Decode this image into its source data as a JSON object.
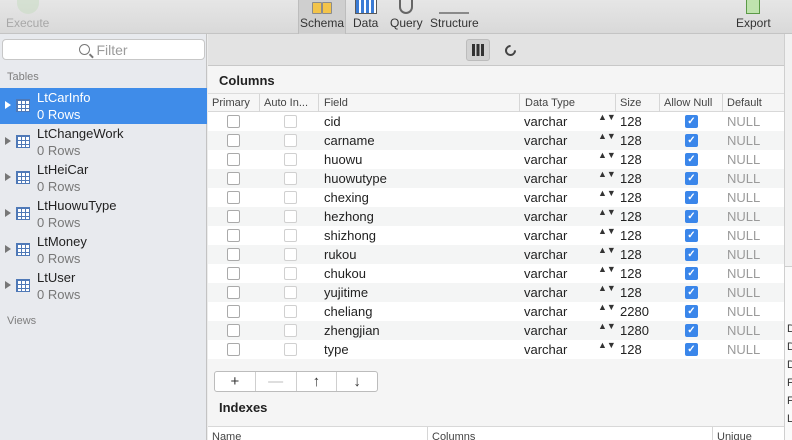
{
  "toolbar": {
    "execute": "Execute",
    "schema": "Schema",
    "data": "Data",
    "query": "Query",
    "structure": "Structure",
    "export": "Export"
  },
  "sidebar": {
    "filter_placeholder": "Filter",
    "tables_label": "Tables",
    "views_label": "Views",
    "tables": [
      {
        "name": "LtCarInfo",
        "rows": "0 Rows"
      },
      {
        "name": "LtChangeWork",
        "rows": "0 Rows"
      },
      {
        "name": "LtHeiCar",
        "rows": "0 Rows"
      },
      {
        "name": "LtHuowuType",
        "rows": "0 Rows"
      },
      {
        "name": "LtMoney",
        "rows": "0 Rows"
      },
      {
        "name": "LtUser",
        "rows": "0 Rows"
      }
    ]
  },
  "columns": {
    "title": "Columns",
    "headers": [
      "Primary",
      "Auto In...",
      "Field",
      "Data Type",
      "Size",
      "Allow Null",
      "Default"
    ],
    "rows": [
      {
        "field": "cid",
        "type": "varchar",
        "size": "128",
        "default": "NULL"
      },
      {
        "field": "carname",
        "type": "varchar",
        "size": "128",
        "default": "NULL"
      },
      {
        "field": "huowu",
        "type": "varchar",
        "size": "128",
        "default": "NULL"
      },
      {
        "field": "huowutype",
        "type": "varchar",
        "size": "128",
        "default": "NULL"
      },
      {
        "field": "chexing",
        "type": "varchar",
        "size": "128",
        "default": "NULL"
      },
      {
        "field": "hezhong",
        "type": "varchar",
        "size": "128",
        "default": "NULL"
      },
      {
        "field": "shizhong",
        "type": "varchar",
        "size": "128",
        "default": "NULL"
      },
      {
        "field": "rukou",
        "type": "varchar",
        "size": "128",
        "default": "NULL"
      },
      {
        "field": "chukou",
        "type": "varchar",
        "size": "128",
        "default": "NULL"
      },
      {
        "field": "yujitime",
        "type": "varchar",
        "size": "128",
        "default": "NULL"
      },
      {
        "field": "cheliang",
        "type": "varchar",
        "size": "2280",
        "default": "NULL"
      },
      {
        "field": "zhengjian",
        "type": "varchar",
        "size": "1280",
        "default": "NULL"
      },
      {
        "field": "type",
        "type": "varchar",
        "size": "128",
        "default": "NULL"
      }
    ]
  },
  "buttons": {
    "add": "+",
    "remove": "—",
    "up": "↑",
    "down": "↓"
  },
  "indexes": {
    "title": "Indexes",
    "headers": [
      "Name",
      "Columns",
      "Unique"
    ]
  },
  "edge_letters": [
    "D",
    "D",
    "D",
    "F",
    "F",
    "L"
  ],
  "checkmark": "✓",
  "updown": "▲▼",
  "colors": {
    "selection": "#3f8ce9",
    "checkbox_on": "#3a86ea"
  }
}
